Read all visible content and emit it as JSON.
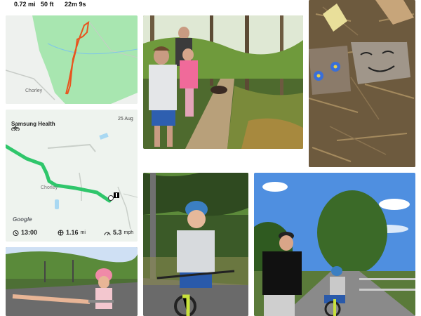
{
  "top_stats": {
    "distance": "0.72 mi",
    "elevation": "50 ft",
    "duration": "22m 9s"
  },
  "map1": {
    "place_label": "Chorley"
  },
  "health_map": {
    "app_title": "Samsung Health",
    "date": "25 Aug",
    "place_label": "Chorley",
    "attribution": "Google",
    "time_value": "13:00",
    "distance_value": "1.16",
    "distance_unit": "mi",
    "speed_value": "5.3",
    "speed_unit": "mph"
  },
  "colors": {
    "route_orange": "#e8541e",
    "route_green": "#2fc66b",
    "map_green": "#a8e6b0",
    "map_bg": "#eef3ee",
    "sky": "#4f8fe0"
  },
  "icons": {
    "bike": "bike-icon",
    "timer": "timer-icon",
    "distance": "distance-icon",
    "speed": "speed-icon",
    "finish": "finish-flag-icon"
  }
}
